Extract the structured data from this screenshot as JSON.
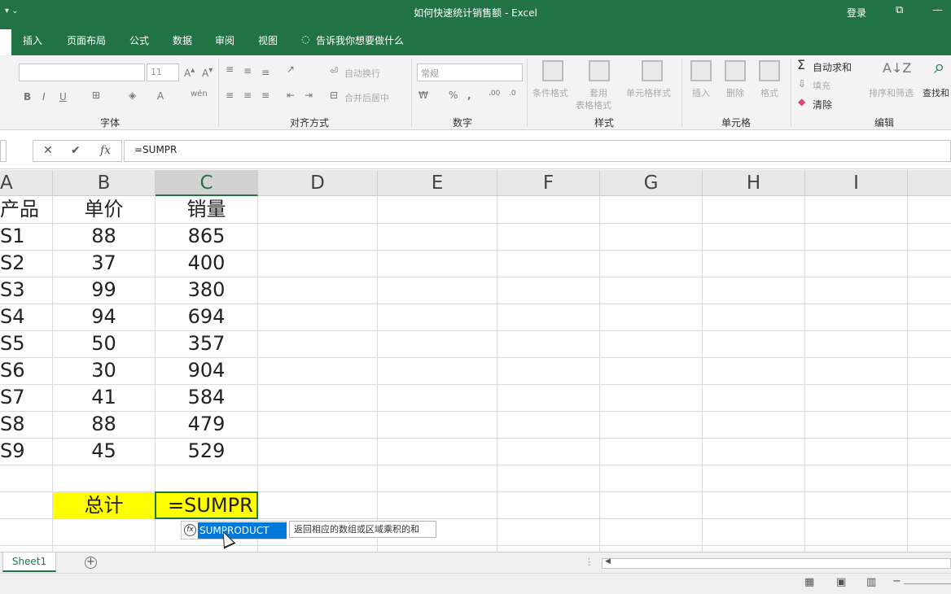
{
  "title_bar": {
    "qat_glyph": "▾ ⌄",
    "window_title": "如何快速统计销售额  -  Excel",
    "login": "登录",
    "restore_glyph": "⧉",
    "minimize_glyph": "—",
    "close_glyph": "✕",
    "bg_color": "#217346"
  },
  "tabs": [
    "插入",
    "页面布局",
    "公式",
    "数据",
    "审阅",
    "视图"
  ],
  "tell_me": "告诉我你想要做什么",
  "ribbon": {
    "font_name": "",
    "font_size": "11",
    "font_group": "字体",
    "align_group": "对齐方式",
    "wrap_text": "自动换行",
    "merge_center": "合并后居中",
    "number_format": "常规",
    "number_group": "数字",
    "cond_format": "条件格式",
    "table_format_1": "套用",
    "table_format_2": "表格格式",
    "cell_style": "单元格样式",
    "styles_group": "样式",
    "insert": "插入",
    "delete": "删除",
    "format": "格式",
    "cells_group": "单元格",
    "autosum": "自动求和",
    "fill": "填充",
    "clear": "清除",
    "sort_filter": "排序和筛选",
    "find_select": "查找和",
    "edit_group": "编辑"
  },
  "formula_bar": {
    "cancel": "✕",
    "confirm": "✔",
    "fx": "fx",
    "value": "=SUMPR"
  },
  "columns": [
    "A",
    "B",
    "C",
    "D",
    "E",
    "F",
    "G",
    "H",
    "I"
  ],
  "table": {
    "headers": [
      "产品",
      "单价",
      "销量"
    ],
    "rows": [
      [
        "S1",
        "88",
        "865"
      ],
      [
        "S2",
        "37",
        "400"
      ],
      [
        "S3",
        "99",
        "380"
      ],
      [
        "S4",
        "94",
        "694"
      ],
      [
        "S5",
        "50",
        "357"
      ],
      [
        "S6",
        "30",
        "904"
      ],
      [
        "S7",
        "41",
        "584"
      ],
      [
        "S8",
        "88",
        "479"
      ],
      [
        "S9",
        "45",
        "529"
      ]
    ],
    "total_label": "总计",
    "editing_value": "=SUMPR"
  },
  "autocomplete": {
    "function": "SUMPRODUCT",
    "fx_glyph": "fx",
    "tooltip": "返回相应的数组或区域乘积的和"
  },
  "sheets": [
    "Sheet1"
  ],
  "add_sheet": "⊕",
  "status_bar": {
    "normal_view": "▦",
    "page_layout_view": "▣",
    "page_break_view": "▥",
    "zoom_out": "−"
  }
}
